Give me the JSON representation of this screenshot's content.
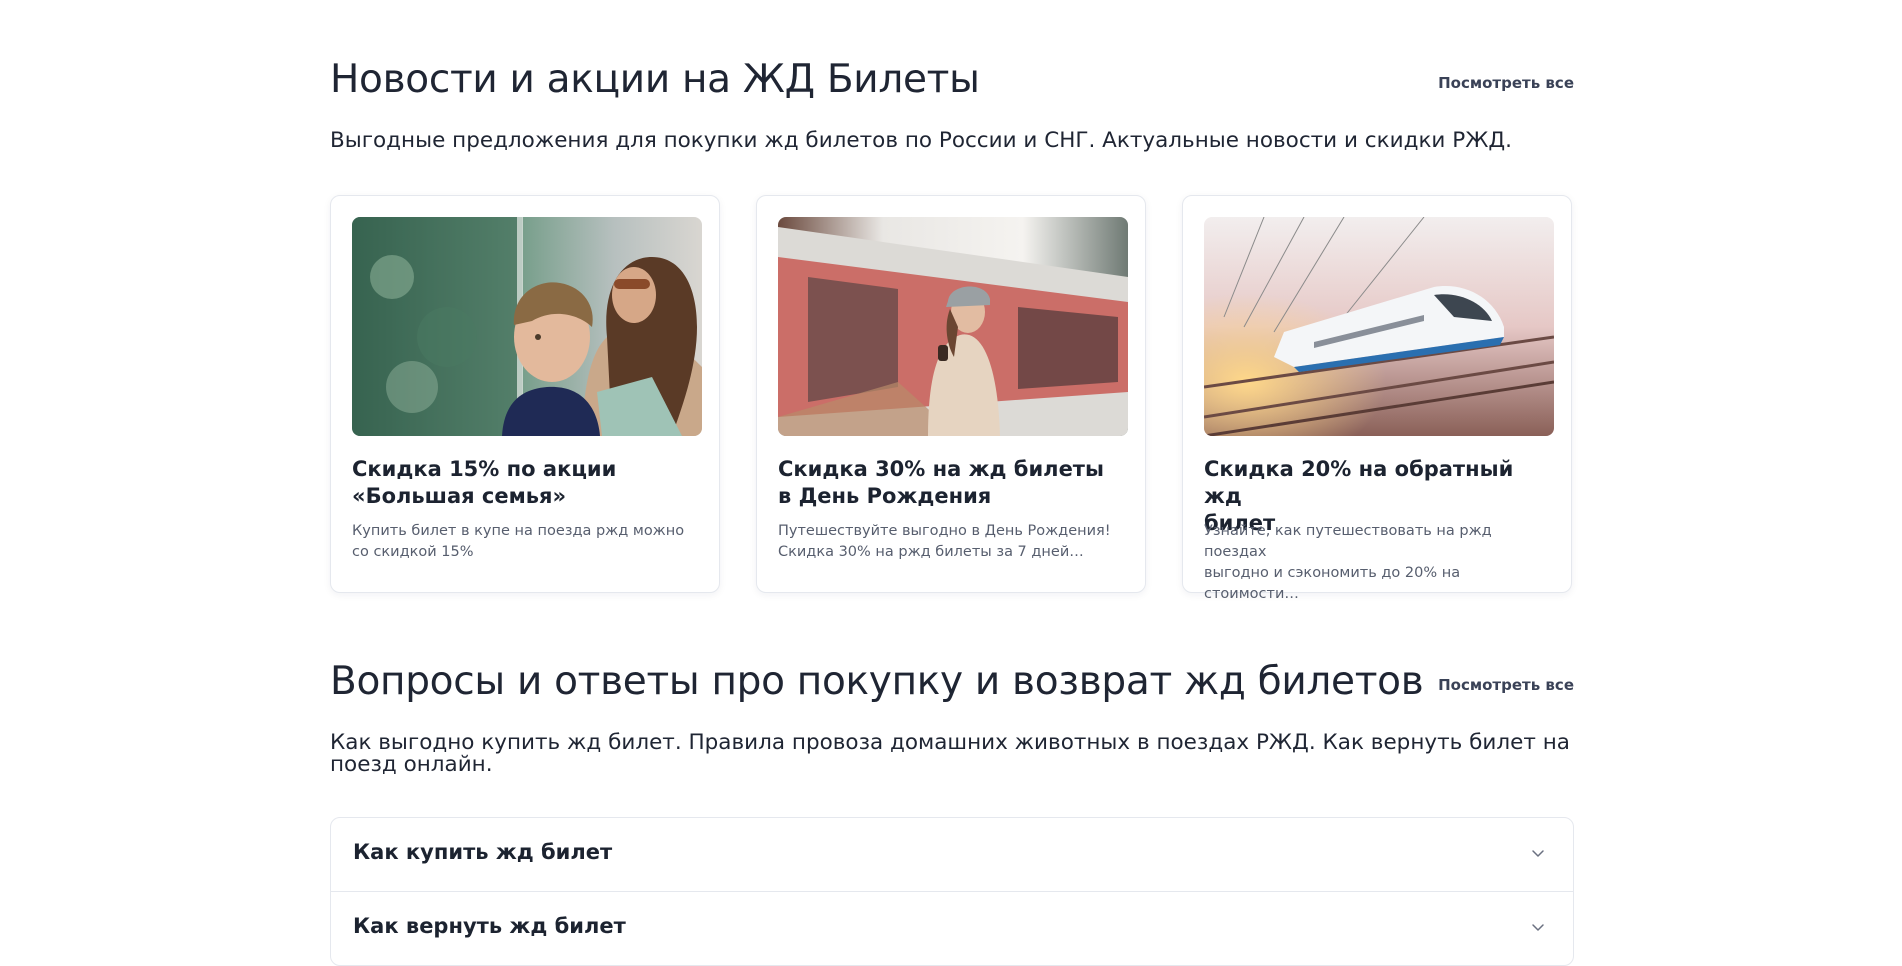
{
  "news": {
    "title": "Новости и акции на ЖД Билеты",
    "see_all": "Посмотреть все",
    "description": "Выгодные предложения для покупки жд билетов по России и СНГ. Актуальные новости и скидки РЖД.",
    "cards": [
      {
        "title": "Скидка 15% по акции\n«Большая семья»",
        "text": "Купить билет в купе на поезда ржд можно\nсо скидкой 15%",
        "image": "family-in-train-photo"
      },
      {
        "title": "Скидка 30% на жд билеты\nв День Рождения",
        "text": "Путешествуйте выгодно в День Рождения!\nСкидка 30% на ржд билеты за 7 дней…",
        "image": "woman-on-platform-photo"
      },
      {
        "title": "Скидка 20% на обратный жд\nбилет",
        "text": "Узнайте, как путешествовать на ржд поездах\nвыгодно и сэкономить до 20% на стоимости…",
        "image": "high-speed-train-photo"
      }
    ]
  },
  "faq": {
    "title": "Вопросы и ответы про покупку и возврат жд билетов",
    "see_all": "Посмотреть все",
    "description": "Как выгодно купить жд билет. Правила провоза домашних животных в поездах РЖД. Как вернуть билет на поезд онлайн.",
    "items": [
      {
        "question": "Как купить жд билет"
      },
      {
        "question": "Как вернуть жд билет"
      }
    ]
  },
  "colors": {
    "heading": "#1f2533",
    "link": "#3a4257",
    "muted_text": "#575e6e",
    "border": "#e5e8ee"
  }
}
